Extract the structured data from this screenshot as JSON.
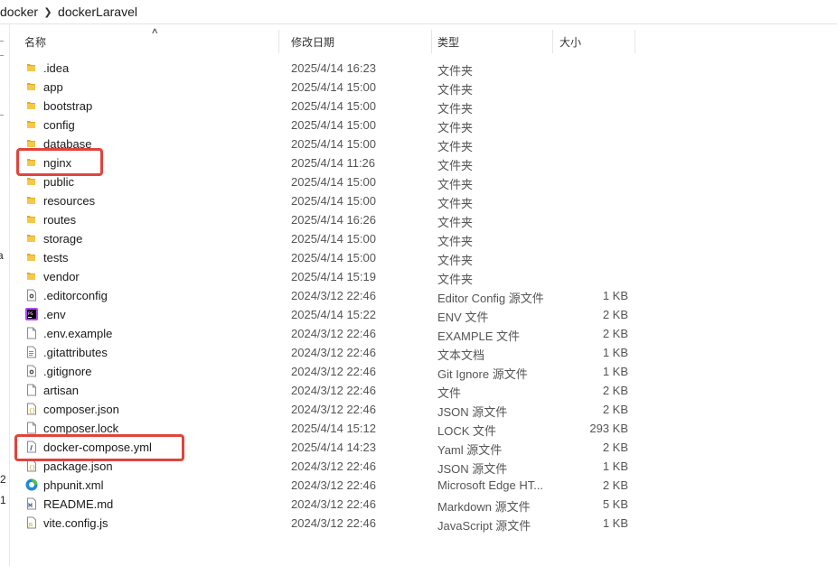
{
  "breadcrumb": {
    "items": [
      "docker",
      "dockerLaravel"
    ]
  },
  "columns": {
    "name": "名称",
    "date": "修改日期",
    "type": "类型",
    "size": "大小"
  },
  "left_strip": {
    "marks": [
      "a",
      "2",
      "1"
    ]
  },
  "files": [
    {
      "name": ".idea",
      "date": "2025/4/14 16:23",
      "type": "文件夹",
      "size": "",
      "icon": "folder-icon"
    },
    {
      "name": "app",
      "date": "2025/4/14 15:00",
      "type": "文件夹",
      "size": "",
      "icon": "folder-icon"
    },
    {
      "name": "bootstrap",
      "date": "2025/4/14 15:00",
      "type": "文件夹",
      "size": "",
      "icon": "folder-icon"
    },
    {
      "name": "config",
      "date": "2025/4/14 15:00",
      "type": "文件夹",
      "size": "",
      "icon": "folder-icon"
    },
    {
      "name": "database",
      "date": "2025/4/14 15:00",
      "type": "文件夹",
      "size": "",
      "icon": "folder-icon"
    },
    {
      "name": "nginx",
      "date": "2025/4/14 11:26",
      "type": "文件夹",
      "size": "",
      "icon": "folder-icon"
    },
    {
      "name": "public",
      "date": "2025/4/14 15:00",
      "type": "文件夹",
      "size": "",
      "icon": "folder-icon"
    },
    {
      "name": "resources",
      "date": "2025/4/14 15:00",
      "type": "文件夹",
      "size": "",
      "icon": "folder-icon"
    },
    {
      "name": "routes",
      "date": "2025/4/14 16:26",
      "type": "文件夹",
      "size": "",
      "icon": "folder-icon"
    },
    {
      "name": "storage",
      "date": "2025/4/14 15:00",
      "type": "文件夹",
      "size": "",
      "icon": "folder-icon"
    },
    {
      "name": "tests",
      "date": "2025/4/14 15:00",
      "type": "文件夹",
      "size": "",
      "icon": "folder-icon"
    },
    {
      "name": "vendor",
      "date": "2025/4/14 15:19",
      "type": "文件夹",
      "size": "",
      "icon": "folder-icon"
    },
    {
      "name": ".editorconfig",
      "date": "2024/3/12 22:46",
      "type": "Editor Config 源文件",
      "size": "1 KB",
      "icon": "gear-file-icon"
    },
    {
      "name": ".env",
      "date": "2025/4/14 15:22",
      "type": "ENV 文件",
      "size": "2 KB",
      "icon": "phpstorm-icon"
    },
    {
      "name": ".env.example",
      "date": "2024/3/12 22:46",
      "type": "EXAMPLE 文件",
      "size": "2 KB",
      "icon": "file-icon"
    },
    {
      "name": ".gitattributes",
      "date": "2024/3/12 22:46",
      "type": "文本文档",
      "size": "1 KB",
      "icon": "text-file-icon"
    },
    {
      "name": ".gitignore",
      "date": "2024/3/12 22:46",
      "type": "Git Ignore 源文件",
      "size": "1 KB",
      "icon": "gear-file-icon"
    },
    {
      "name": "artisan",
      "date": "2024/3/12 22:46",
      "type": "文件",
      "size": "2 KB",
      "icon": "file-icon"
    },
    {
      "name": "composer.json",
      "date": "2024/3/12 22:46",
      "type": "JSON 源文件",
      "size": "2 KB",
      "icon": "json-file-icon"
    },
    {
      "name": "composer.lock",
      "date": "2025/4/14 15:12",
      "type": "LOCK 文件",
      "size": "293 KB",
      "icon": "file-icon"
    },
    {
      "name": "docker-compose.yml",
      "date": "2025/4/14 14:23",
      "type": "Yaml 源文件",
      "size": "2 KB",
      "icon": "yaml-file-icon"
    },
    {
      "name": "package.json",
      "date": "2024/3/12 22:46",
      "type": "JSON 源文件",
      "size": "1 KB",
      "icon": "json-file-icon"
    },
    {
      "name": "phpunit.xml",
      "date": "2024/3/12 22:46",
      "type": "Microsoft Edge HT...",
      "size": "2 KB",
      "icon": "edge-icon"
    },
    {
      "name": "README.md",
      "date": "2024/3/12 22:46",
      "type": "Markdown 源文件",
      "size": "5 KB",
      "icon": "markdown-file-icon"
    },
    {
      "name": "vite.config.js",
      "date": "2024/3/12 22:46",
      "type": "JavaScript 源文件",
      "size": "1 KB",
      "icon": "js-file-icon"
    }
  ],
  "colors": {
    "highlight": "#e0443c",
    "folder": "#f5c84a",
    "folder_dark": "#e5a823"
  }
}
